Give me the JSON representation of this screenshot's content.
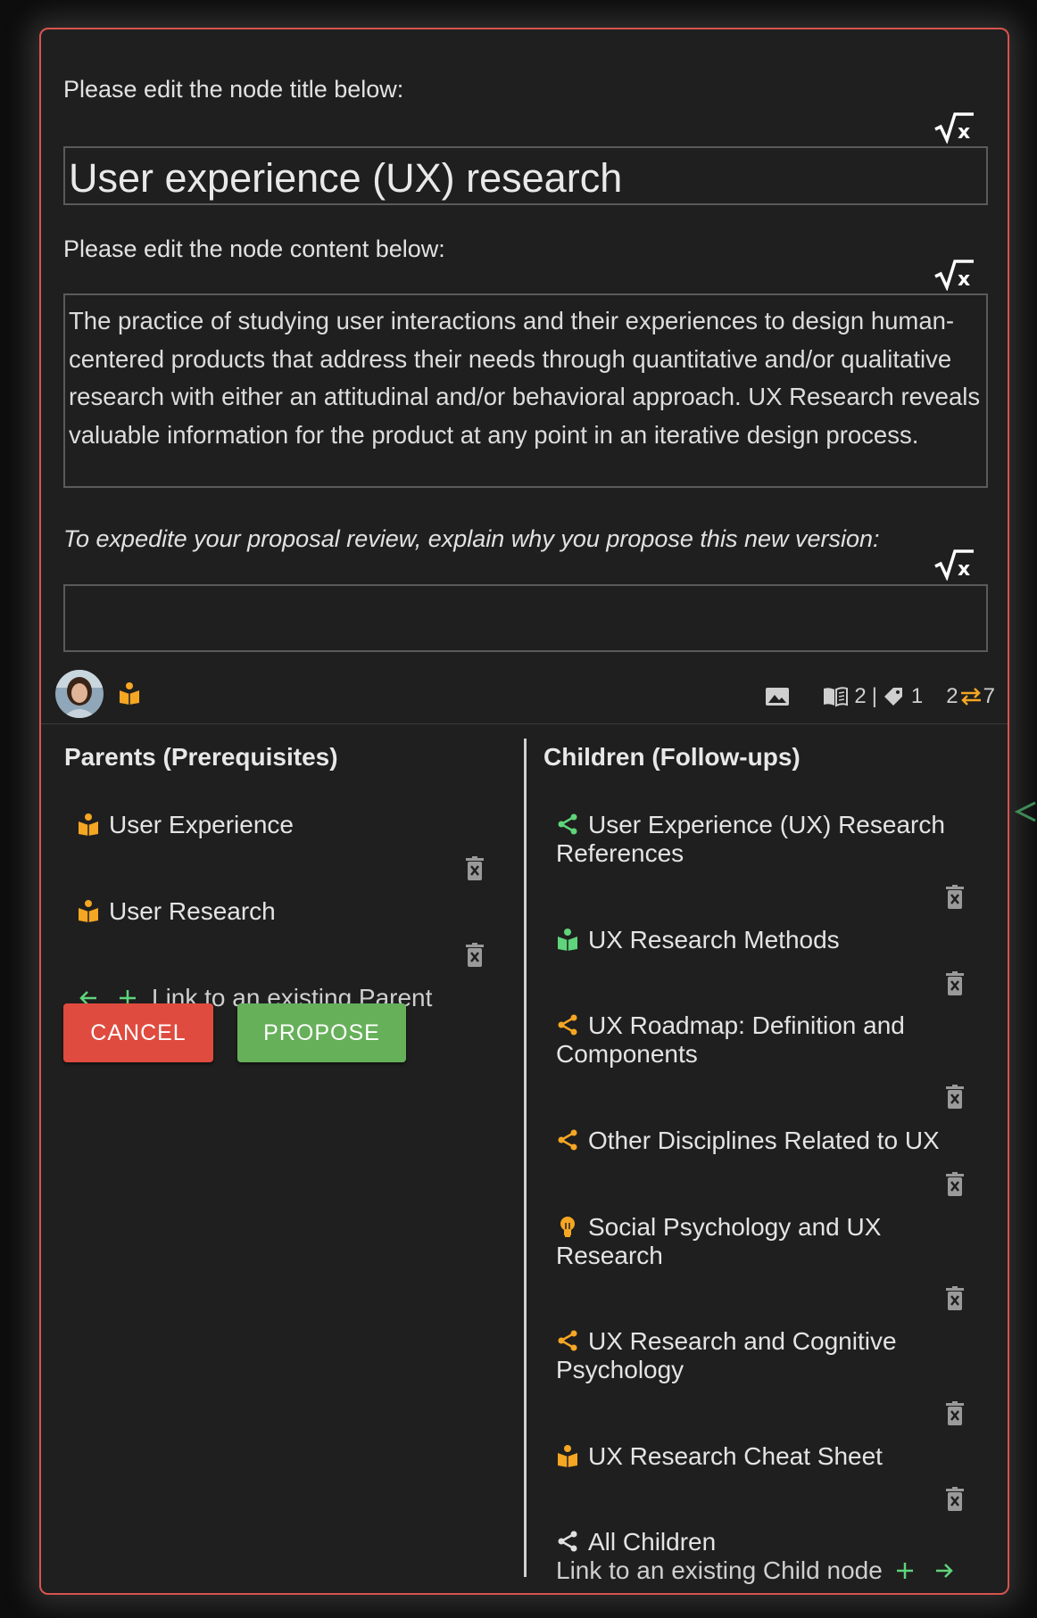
{
  "labels": {
    "title_prompt": "Please edit the node title below:",
    "content_prompt": "Please edit the node content below:",
    "reason_prompt": "To expedite your proposal review, explain why you propose this new version:"
  },
  "node": {
    "title": "User experience (UX) research",
    "content": "The practice of studying user interactions and their experiences to design human-centered products that address their needs through quantitative and/or qualitative research with either an attitudinal and/or behavioral approach. UX Research reveals valuable information for the product at any point in an iterative design process.",
    "reason": ""
  },
  "meta": {
    "references_count": "2",
    "separator": "|",
    "tags_count": "1",
    "parents_count": "2",
    "children_count": "7"
  },
  "parents": {
    "heading": "Parents (Prerequisites)",
    "items": [
      {
        "label": "User Experience",
        "icon": "book-open-icon"
      },
      {
        "label": "User Research",
        "icon": "book-open-icon"
      }
    ],
    "link_label": "Link to an existing Parent"
  },
  "children": {
    "heading": "Children (Follow-ups)",
    "items": [
      {
        "label": "User Experience (UX) Research References",
        "icon": "share-icon"
      },
      {
        "label": "UX Research Methods",
        "icon": "book-open-icon"
      },
      {
        "label": "UX Roadmap: Definition and Components",
        "icon": "share-icon"
      },
      {
        "label": "Other Disciplines Related to UX",
        "icon": "share-icon"
      },
      {
        "label": "Social Psychology and UX Research",
        "icon": "lightbulb-icon"
      },
      {
        "label": "UX Research and Cognitive Psychology",
        "icon": "share-icon"
      },
      {
        "label": "UX Research Cheat Sheet",
        "icon": "book-open-icon"
      }
    ],
    "all_children_label": "All Children",
    "link_label": "Link to an existing Child node"
  },
  "buttons": {
    "cancel": "CANCEL",
    "propose": "PROPOSE"
  },
  "colors": {
    "accent_orange": "#f5a623",
    "accent_green": "#5fd47a",
    "cancel_red": "#e04b3f",
    "propose_green": "#66b05a",
    "border_red": "#d9534f"
  }
}
